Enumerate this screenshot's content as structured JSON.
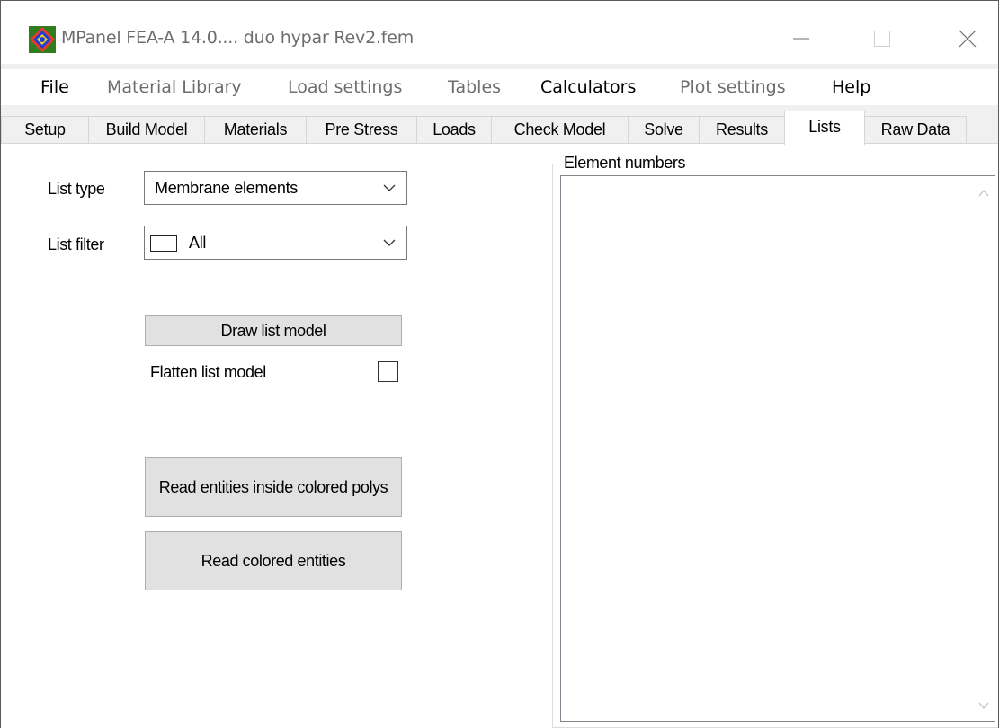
{
  "window": {
    "title": "MPanel FEA-A 14.0.... duo hypar Rev2.fem",
    "icon": "mpanel-app-icon"
  },
  "menu": [
    {
      "label": "File",
      "enabled": true
    },
    {
      "label": "Material Library",
      "enabled": false
    },
    {
      "label": "Load settings",
      "enabled": false
    },
    {
      "label": "Tables",
      "enabled": false
    },
    {
      "label": "Calculators",
      "enabled": true
    },
    {
      "label": "Plot settings",
      "enabled": false
    },
    {
      "label": "Help",
      "enabled": true
    }
  ],
  "tabs": [
    {
      "label": "Setup"
    },
    {
      "label": "Build Model"
    },
    {
      "label": "Materials"
    },
    {
      "label": "Pre Stress"
    },
    {
      "label": "Loads"
    },
    {
      "label": "Check Model"
    },
    {
      "label": "Solve"
    },
    {
      "label": "Results"
    },
    {
      "label": "Lists",
      "active": true
    },
    {
      "label": "Raw Data"
    }
  ],
  "lists": {
    "list_type_label": "List type",
    "list_type_value": "Membrane elements",
    "list_filter_label": "List filter",
    "list_filter_value": "All",
    "draw_button": "Draw list model",
    "flatten_label": "Flatten list model",
    "flatten_checked": false,
    "read_inside_button": "Read entities inside colored polys",
    "read_colored_button": "Read colored entities",
    "element_numbers_label": "Element numbers",
    "element_numbers": []
  }
}
